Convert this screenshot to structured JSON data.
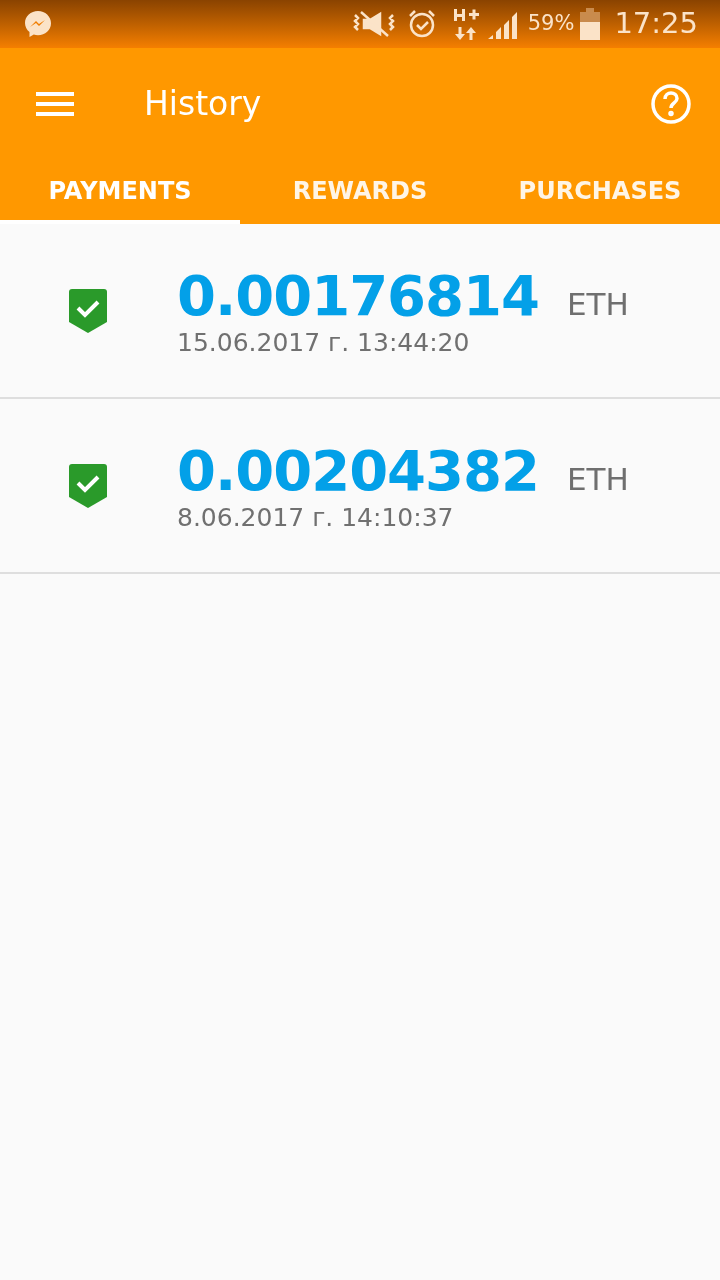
{
  "status_bar": {
    "battery_text": "59%",
    "time": "17:25"
  },
  "app_bar": {
    "title": "History"
  },
  "tabs": [
    {
      "label": "PAYMENTS",
      "selected": true
    },
    {
      "label": "REWARDS",
      "selected": false
    },
    {
      "label": "PURCHASES",
      "selected": false
    }
  ],
  "transactions": [
    {
      "kind": "confirmed",
      "amount": "0.00176814",
      "currency": "ETH",
      "date": "15.06.2017 г. 13:44:20"
    },
    {
      "kind": "confirmed",
      "amount": "0.00204382",
      "currency": "ETH",
      "date": "8.06.2017 г. 14:10:37"
    }
  ]
}
